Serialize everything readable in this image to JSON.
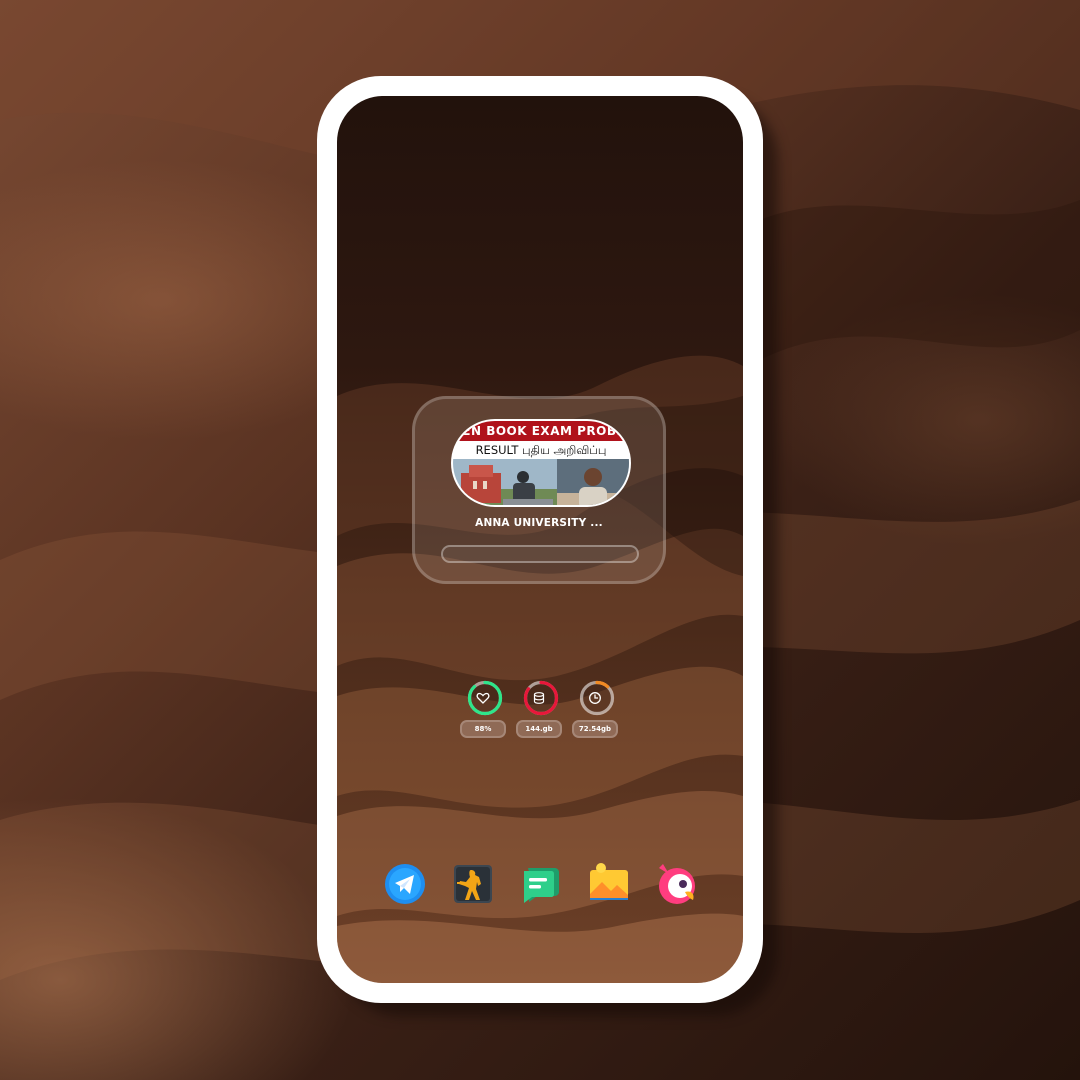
{
  "widget": {
    "thumbnail_banner": "PEN BOOK EXAM PROBLEMS",
    "thumbnail_subtitle": "RESULT புதிய அறிவிப்பு",
    "title": "ANNA UNIVERSITY ...",
    "progress": 0
  },
  "stats": [
    {
      "icon": "heart-icon",
      "value": "88%",
      "ring_color": "#2ee58a",
      "percent": 88
    },
    {
      "icon": "storage-icon",
      "value": "144.gb",
      "ring_color": "#e8173a",
      "percent": 85
    },
    {
      "icon": "clock-icon",
      "value": "72.54gb",
      "ring_color": "#f08a24",
      "percent": 12
    }
  ],
  "dock": [
    {
      "name": "telegram-app-icon"
    },
    {
      "name": "game-app-icon"
    },
    {
      "name": "messages-app-icon"
    },
    {
      "name": "gallery-app-icon"
    },
    {
      "name": "bird-app-icon"
    }
  ],
  "colors": {
    "frame": "#ffffff",
    "background_dark": "#24130c",
    "background_light": "#7a4a33"
  }
}
